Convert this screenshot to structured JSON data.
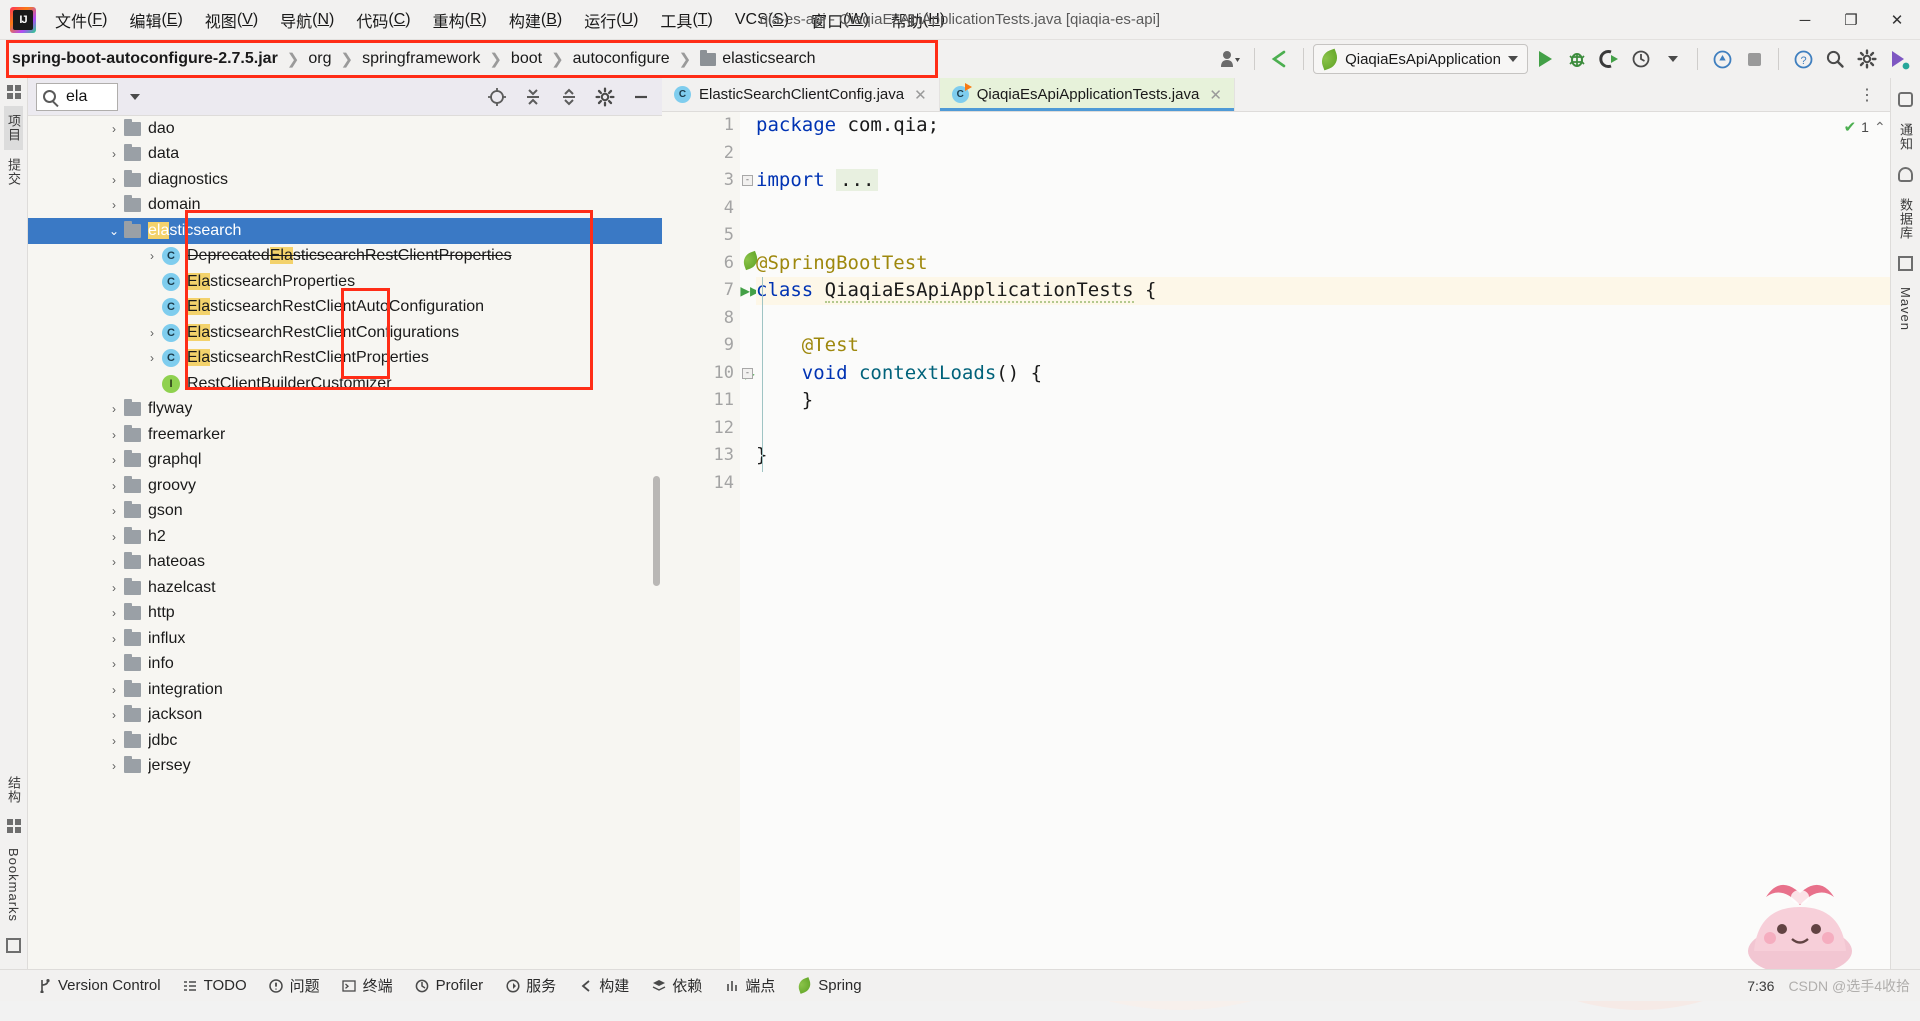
{
  "window": {
    "title": "qia-es-api - QiaqiaEsApiApplicationTests.java [qiaqia-es-api]",
    "minimize": "─",
    "maximize": "❐",
    "close": "✕"
  },
  "menu": [
    {
      "label": "文件",
      "mnemonic": "F"
    },
    {
      "label": "编辑",
      "mnemonic": "E"
    },
    {
      "label": "视图",
      "mnemonic": "V"
    },
    {
      "label": "导航",
      "mnemonic": "N"
    },
    {
      "label": "代码",
      "mnemonic": "C"
    },
    {
      "label": "重构",
      "mnemonic": "R"
    },
    {
      "label": "构建",
      "mnemonic": "B"
    },
    {
      "label": "运行",
      "mnemonic": "U"
    },
    {
      "label": "工具",
      "mnemonic": "T"
    },
    {
      "label": "VCS",
      "mnemonic": "S"
    },
    {
      "label": "窗口",
      "mnemonic": "W"
    },
    {
      "label": "帮助",
      "mnemonic": "H"
    }
  ],
  "breadcrumb": {
    "separator": "❯",
    "items": [
      {
        "label": "spring-boot-autoconfigure-2.7.5.jar",
        "bold": true,
        "folder": false
      },
      {
        "label": "org",
        "bold": false,
        "folder": false
      },
      {
        "label": "springframework",
        "bold": false,
        "folder": false
      },
      {
        "label": "boot",
        "bold": false,
        "folder": false
      },
      {
        "label": "autoconfigure",
        "bold": false,
        "folder": false
      },
      {
        "label": "elasticsearch",
        "bold": false,
        "folder": true
      }
    ]
  },
  "toolbar": {
    "run_config": "QiaqiaEsApiApplication",
    "run_title": "运行",
    "debug_title": "调试",
    "coverage_title": "运行覆盖率",
    "profiler_title": "性能分析",
    "stop_title": "停止",
    "search_everywhere_title": "搜索",
    "settings_title": "设置",
    "updates_title": "更新"
  },
  "project_panel": {
    "search_value": "ela",
    "search_placeholder": "搜索",
    "toolbar_icons": [
      "locate-icon",
      "expand-all-icon",
      "collapse-all-icon",
      "settings-icon",
      "hide-icon"
    ],
    "tree": [
      {
        "label": "dao",
        "type": "folder",
        "depth": 2,
        "arrow": "›",
        "selected": false
      },
      {
        "label": "data",
        "type": "folder",
        "depth": 2,
        "arrow": "›",
        "selected": false
      },
      {
        "label": "diagnostics",
        "type": "folder",
        "depth": 2,
        "arrow": "›",
        "selected": false
      },
      {
        "label": "domain",
        "type": "folder",
        "depth": 2,
        "arrow": "›",
        "selected": false
      },
      {
        "label": "elasticsearch",
        "type": "folder",
        "depth": 2,
        "arrow": "⌄",
        "selected": true,
        "highlight": "ela"
      },
      {
        "label": "DeprecatedElasticsearchRestClientProperties",
        "type": "class",
        "depth": 3,
        "arrow": "›",
        "selected": false,
        "highlight": "Ela",
        "strike": true
      },
      {
        "label": "ElasticsearchProperties",
        "type": "class",
        "depth": 3,
        "arrow": "",
        "selected": false,
        "highlight": "Ela"
      },
      {
        "label": "ElasticsearchRestClientAutoConfiguration",
        "type": "class",
        "depth": 3,
        "arrow": "",
        "selected": false,
        "highlight": "Ela"
      },
      {
        "label": "ElasticsearchRestClientConfigurations",
        "type": "class",
        "depth": 3,
        "arrow": "›",
        "selected": false,
        "highlight": "Ela"
      },
      {
        "label": "ElasticsearchRestClientProperties",
        "type": "class",
        "depth": 3,
        "arrow": "›",
        "selected": false,
        "highlight": "Ela"
      },
      {
        "label": "RestClientBuilderCustomizer",
        "type": "interface",
        "depth": 3,
        "arrow": "",
        "selected": false
      },
      {
        "label": "flyway",
        "type": "folder",
        "depth": 2,
        "arrow": "›",
        "selected": false
      },
      {
        "label": "freemarker",
        "type": "folder",
        "depth": 2,
        "arrow": "›",
        "selected": false
      },
      {
        "label": "graphql",
        "type": "folder",
        "depth": 2,
        "arrow": "›",
        "selected": false
      },
      {
        "label": "groovy",
        "type": "folder",
        "depth": 2,
        "arrow": "›",
        "selected": false
      },
      {
        "label": "gson",
        "type": "folder",
        "depth": 2,
        "arrow": "›",
        "selected": false
      },
      {
        "label": "h2",
        "type": "folder",
        "depth": 2,
        "arrow": "›",
        "selected": false
      },
      {
        "label": "hateoas",
        "type": "folder",
        "depth": 2,
        "arrow": "›",
        "selected": false
      },
      {
        "label": "hazelcast",
        "type": "folder",
        "depth": 2,
        "arrow": "›",
        "selected": false
      },
      {
        "label": "http",
        "type": "folder",
        "depth": 2,
        "arrow": "›",
        "selected": false
      },
      {
        "label": "influx",
        "type": "folder",
        "depth": 2,
        "arrow": "›",
        "selected": false
      },
      {
        "label": "info",
        "type": "folder",
        "depth": 2,
        "arrow": "›",
        "selected": false
      },
      {
        "label": "integration",
        "type": "folder",
        "depth": 2,
        "arrow": "›",
        "selected": false
      },
      {
        "label": "jackson",
        "type": "folder",
        "depth": 2,
        "arrow": "›",
        "selected": false
      },
      {
        "label": "jdbc",
        "type": "folder",
        "depth": 2,
        "arrow": "›",
        "selected": false
      },
      {
        "label": "jersey",
        "type": "folder",
        "depth": 2,
        "arrow": "›",
        "selected": false
      }
    ]
  },
  "left_stripe": {
    "top": [
      "项目",
      "提交"
    ],
    "bottom": [
      "结构",
      "Bookmarks"
    ]
  },
  "right_stripe": [
    "通知",
    "数据库",
    "Maven"
  ],
  "editor": {
    "tabs": [
      {
        "label": "ElasticSearchClientConfig.java",
        "active": false,
        "icon": "java-class-icon"
      },
      {
        "label": "QiaqiaEsApiApplicationTests.java",
        "active": true,
        "icon": "java-test-class-icon"
      }
    ],
    "inspection_count": "1",
    "lines": [
      {
        "n": "1",
        "tokens": [
          {
            "t": "package",
            "c": "kw"
          },
          {
            "t": " com.qia;",
            "c": "plain"
          }
        ],
        "gmark": "",
        "hi": false
      },
      {
        "n": "2",
        "tokens": [],
        "gmark": "",
        "hi": false
      },
      {
        "n": "3",
        "tokens": [
          {
            "t": "import ",
            "c": "kw"
          },
          {
            "t": "...",
            "c": "ell"
          }
        ],
        "gmark": "",
        "hi": false,
        "fold": "-"
      },
      {
        "n": "4",
        "tokens": [],
        "gmark": "",
        "hi": false
      },
      {
        "n": "5",
        "tokens": [],
        "gmark": "",
        "hi": false
      },
      {
        "n": "6",
        "tokens": [
          {
            "t": "@SpringBootTest",
            "c": "ann"
          }
        ],
        "gmark": "spring-leaf-icon",
        "hi": false
      },
      {
        "n": "7",
        "tokens": [
          {
            "t": "class",
            "c": "kw"
          },
          {
            "t": " ",
            "c": "plain"
          },
          {
            "t": "QiaqiaEsApiApplicationTests",
            "c": "sq"
          },
          {
            "t": " {",
            "c": "plain"
          }
        ],
        "gmark": "run-all-icon",
        "hi": true
      },
      {
        "n": "8",
        "tokens": [],
        "gmark": "",
        "hi": false
      },
      {
        "n": "9",
        "tokens": [
          {
            "t": "    @Test",
            "c": "ann"
          }
        ],
        "gmark": "",
        "hi": false
      },
      {
        "n": "10",
        "tokens": [
          {
            "t": "    ",
            "c": "plain"
          },
          {
            "t": "void",
            "c": "kw"
          },
          {
            "t": " ",
            "c": "plain"
          },
          {
            "t": "contextLoads",
            "c": "mth"
          },
          {
            "t": "() {",
            "c": "plain"
          }
        ],
        "gmark": "run-icon",
        "hi": false,
        "fold": "-"
      },
      {
        "n": "11",
        "tokens": [
          {
            "t": "    }",
            "c": "plain"
          }
        ],
        "gmark": "",
        "hi": false
      },
      {
        "n": "12",
        "tokens": [],
        "gmark": "",
        "hi": false
      },
      {
        "n": "13",
        "tokens": [
          {
            "t": "}",
            "c": "plain"
          }
        ],
        "gmark": "",
        "hi": false
      },
      {
        "n": "14",
        "tokens": [],
        "gmark": "",
        "hi": false
      }
    ]
  },
  "bottom_bar": {
    "items": [
      {
        "label": "Version Control",
        "icon": "branch-icon"
      },
      {
        "label": "TODO",
        "icon": "list-icon"
      },
      {
        "label": "问题",
        "icon": "warning-icon"
      },
      {
        "label": "终端",
        "icon": "terminal-icon"
      },
      {
        "label": "Profiler",
        "icon": "profiler-icon"
      },
      {
        "label": "服务",
        "icon": "services-icon"
      },
      {
        "label": "构建",
        "icon": "build-icon"
      },
      {
        "label": "依赖",
        "icon": "dependencies-icon"
      },
      {
        "label": "端点",
        "icon": "endpoints-icon"
      },
      {
        "label": "Spring",
        "icon": "spring-leaf-icon"
      }
    ],
    "time": "7:36",
    "watermark": "CSDN @选手4收拾"
  },
  "colors": {
    "accent_red": "#ff2d17",
    "selection_blue": "#3a79c5",
    "highlight_yellow": "#f3d26b",
    "keyword_blue": "#0033b3",
    "annotation_gold": "#9e880d",
    "method_teal": "#00627a",
    "run_green": "#43a047"
  }
}
